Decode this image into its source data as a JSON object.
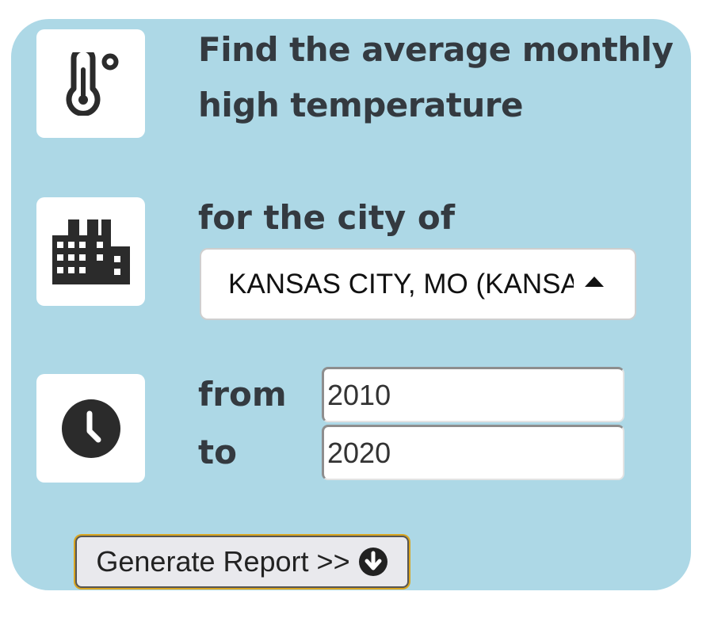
{
  "form": {
    "heading": {
      "line1": "Find the average monthly",
      "line2": "high temperature"
    },
    "city": {
      "label": "for the city of",
      "selected": "KANSAS CITY, MO (KANSAS CITY INTERNATIONAL AIRPORT)"
    },
    "range": {
      "from_label": "from",
      "from_value": "2010",
      "to_label": "to",
      "to_value": "2020"
    },
    "generate_button": {
      "label": "Generate Report >>"
    }
  },
  "icons": {
    "temperature": "thermometer-degree-icon",
    "city": "city-buildings-icon",
    "time": "clock-icon",
    "generate": "arrow-circle-down-icon"
  },
  "colors": {
    "panel_bg": "#add8e6",
    "heading_text": "#343a40",
    "button_focus_ring": "#d9a520"
  }
}
